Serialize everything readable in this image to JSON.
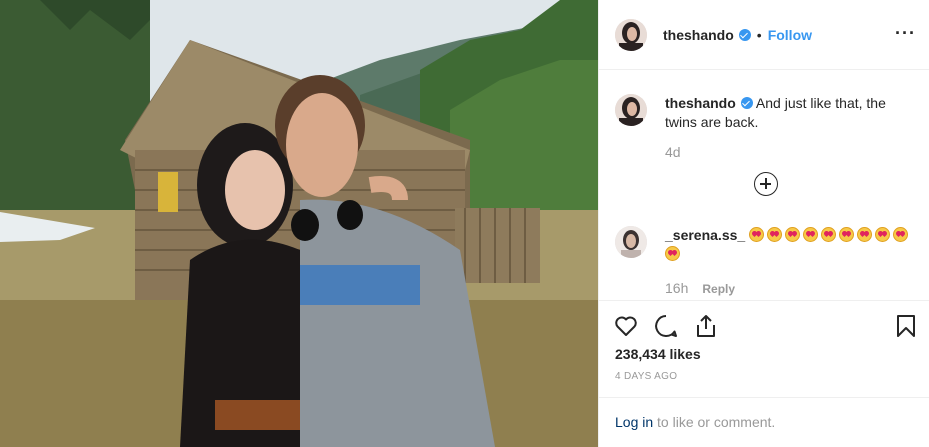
{
  "post": {
    "username": "theshando",
    "dot": "•",
    "follow_label": "Follow",
    "more_label": "···",
    "caption_text": "And just like that, the twins are back.",
    "caption_age": "4d"
  },
  "comments": [
    {
      "username": "_serena.ss_",
      "emoji_name": "heart-eyes-emoji",
      "emoji_count": 10,
      "age": "16h",
      "reply_label": "Reply"
    }
  ],
  "stats": {
    "likes": "238,434 likes",
    "date": "4 DAYS AGO"
  },
  "footer": {
    "login_link": "Log in",
    "login_rest": " to like or comment."
  },
  "icons": {
    "like": "heart-icon",
    "comment": "comment-icon",
    "share": "share-icon",
    "save": "bookmark-icon",
    "load_more": "plus-circle-icon",
    "verified": "verified-badge-icon"
  },
  "colors": {
    "link_blue": "#3897f0",
    "login_blue": "#003569",
    "muted": "#999999",
    "text": "#262626",
    "border": "#efefef"
  }
}
